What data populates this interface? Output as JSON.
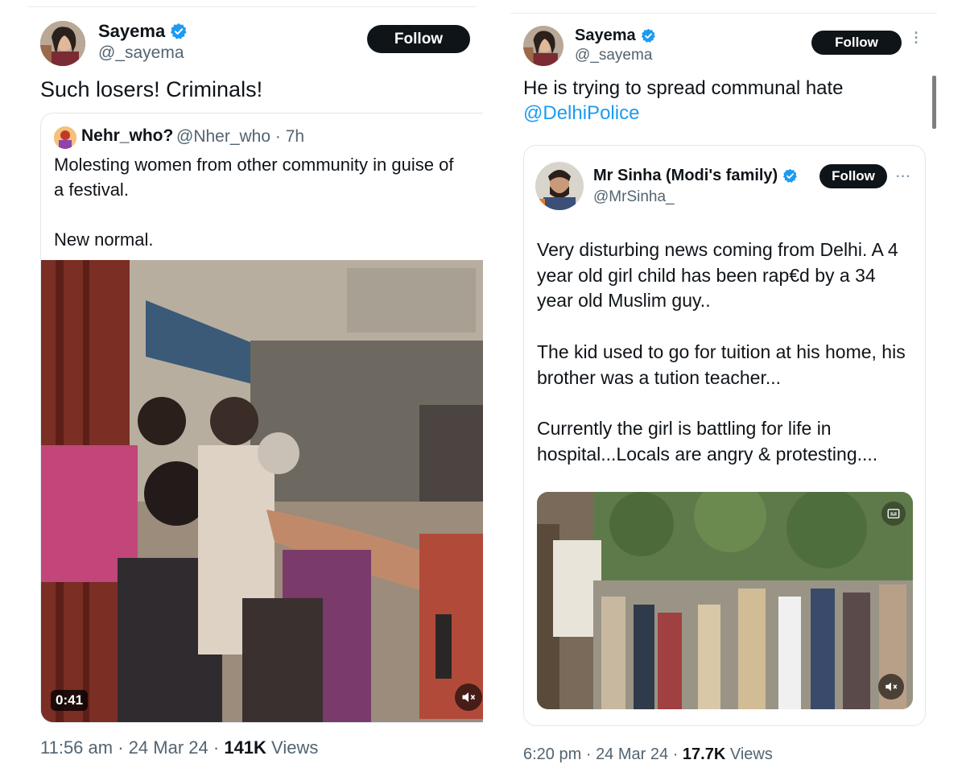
{
  "left_tweet": {
    "author": {
      "name": "Sayema",
      "handle": "@_sayema",
      "verified": true
    },
    "follow_label": "Follow",
    "text": "Such losers! Criminals!",
    "quoted": {
      "author": {
        "name": "Nehr_who?",
        "handle": "@Nher_who",
        "time": "· 7h"
      },
      "text": "Molesting women from other community in guise of\na festival.\n\nNew normal.",
      "video": {
        "duration": "0:41",
        "muted_icon": "speaker-muted-icon"
      }
    },
    "meta": {
      "time": "11:56 am",
      "sep1": "·",
      "date": "24 Mar 24",
      "sep2": "·",
      "views_count": "141K",
      "views_label": "Views"
    }
  },
  "right_tweet": {
    "author": {
      "name": "Sayema",
      "handle": "@_sayema",
      "verified": true
    },
    "follow_label": "Follow",
    "more_icon": "vertical-dots-icon",
    "text": "He is trying to spread communal hate",
    "mention": "@DelhiPolice",
    "quoted": {
      "author": {
        "name": "Mr Sinha (Modi's family)",
        "handle": "@MrSinha_",
        "verified": true
      },
      "follow_label": "Follow",
      "more_icon": "horizontal-dots-icon",
      "text": "Very disturbing news coming from Delhi. A 4\nyear old girl child has been rap€d by a 34\nyear old Muslim guy..\n\nThe kid used to go for tuition at his home, his\nbrother was a tution teacher...\n\nCurrently the girl is battling for life in\nhospital...Locals are angry & protesting....",
      "video": {
        "muted_icon": "speaker-muted-icon",
        "caption_icon": "captions-icon"
      }
    },
    "meta": {
      "time": "6:20 pm",
      "sep1": "·",
      "date": "24 Mar 24",
      "sep2": "·",
      "views_count": "17.7K",
      "views_label": "Views"
    }
  },
  "colors": {
    "verified": "#1d9bf0",
    "link": "#1d9bf0",
    "secondary_text": "#536471",
    "follow_bg": "#0f1419"
  }
}
